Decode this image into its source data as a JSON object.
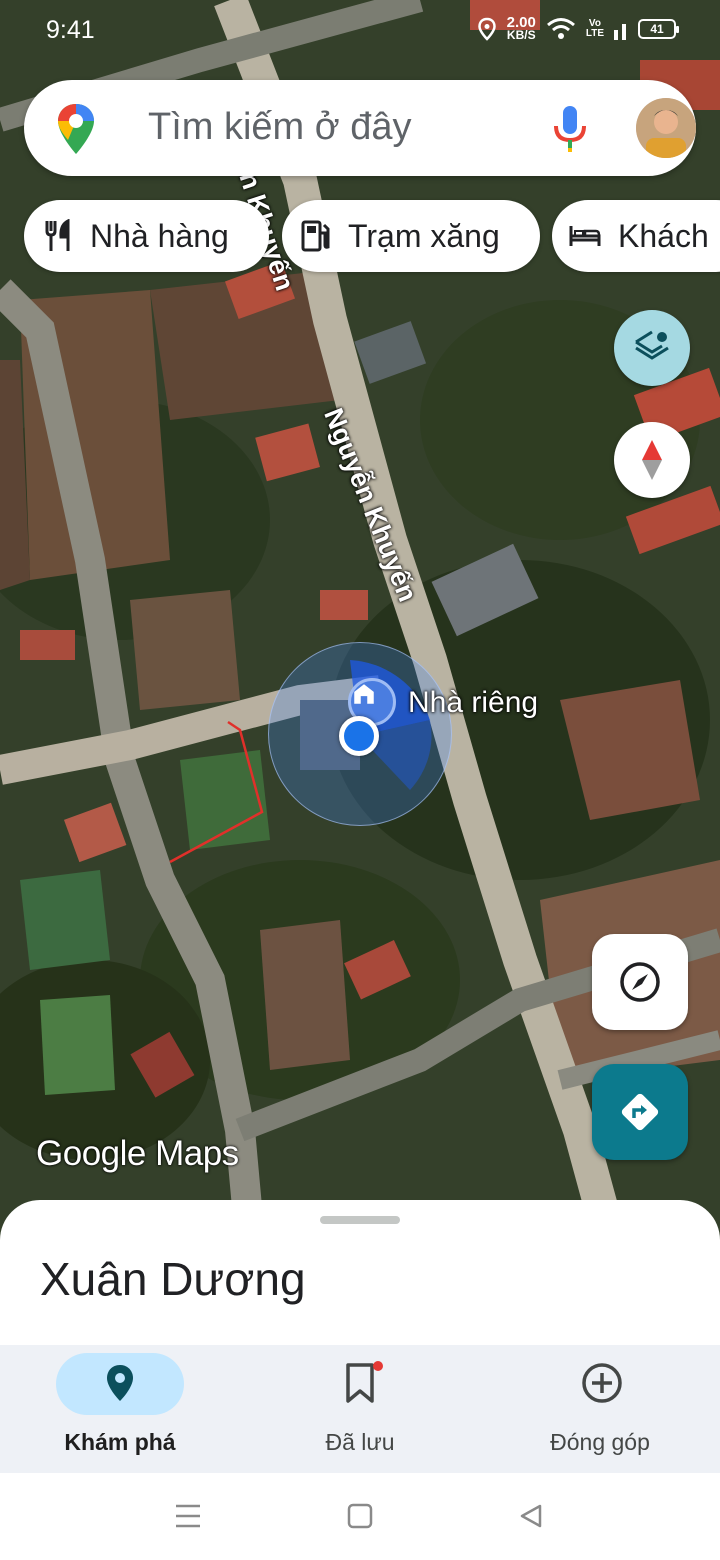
{
  "status_bar": {
    "time": "9:41",
    "net_speed_value": "2.00",
    "net_speed_unit": "KB/S",
    "volte_top": "Vo",
    "volte_bottom": "LTE",
    "battery": "41",
    "icons": [
      "location-icon",
      "wifi-icon",
      "signal-icon",
      "battery-icon"
    ]
  },
  "search": {
    "placeholder": "Tìm kiếm ở đây",
    "icons": [
      "google-maps-pin-icon",
      "mic-icon"
    ]
  },
  "chips": [
    {
      "label": "Nhà hàng",
      "icon": "restaurant-icon"
    },
    {
      "label": "Trạm xăng",
      "icon": "gas-station-icon"
    },
    {
      "label": "Khách",
      "icon": "hotel-bed-icon"
    }
  ],
  "map": {
    "street_name": "Nguyễn Khuyến",
    "street_name_partial": "n Khuyến",
    "home_label": "Nhà riêng",
    "logo_text": "Google Maps"
  },
  "sheet": {
    "title": "Xuân Dương"
  },
  "bottom_nav": [
    {
      "label": "Khám phá",
      "icon": "explore-pin-icon",
      "active": true
    },
    {
      "label": "Đã lưu",
      "icon": "bookmark-icon",
      "active": false,
      "badge": true
    },
    {
      "label": "Đóng góp",
      "icon": "add-circle-icon",
      "active": false
    }
  ],
  "system_nav": [
    "recents-icon",
    "home-square-icon",
    "back-triangle-icon"
  ],
  "colors": {
    "accent_blue": "#1a73e8",
    "directions_teal": "#0c7a8d",
    "layers_bg": "#a5d9e2",
    "active_nav_pill": "#c2e7ff"
  }
}
